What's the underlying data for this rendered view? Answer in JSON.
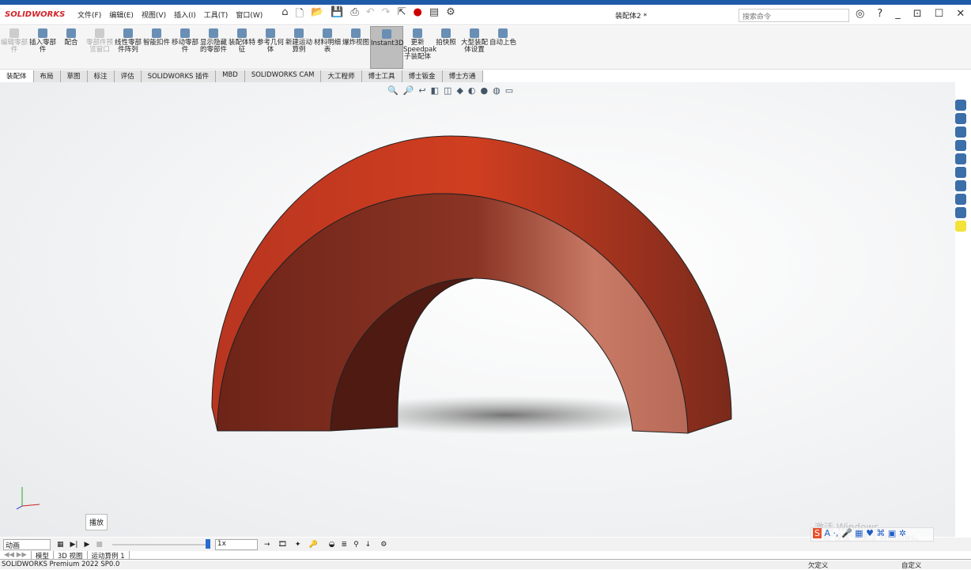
{
  "app": {
    "logo": "SOLIDWORKS",
    "title": "装配体2 *",
    "search_placeholder": "搜索命令"
  },
  "menu": [
    "文件(F)",
    "编辑(E)",
    "视图(V)",
    "插入(I)",
    "工具(T)",
    "窗口(W)"
  ],
  "ribbon": [
    {
      "label": "编辑零部件",
      "disabled": true
    },
    {
      "label": "插入零部件"
    },
    {
      "label": "配合"
    },
    {
      "label": "零部件预览窗口",
      "disabled": true
    },
    {
      "label": "线性零部件阵列"
    },
    {
      "label": "智能扣件"
    },
    {
      "label": "移动零部件"
    },
    {
      "label": "显示隐藏的零部件"
    },
    {
      "label": "装配体特征"
    },
    {
      "label": "参考几何体"
    },
    {
      "label": "新建运动算例"
    },
    {
      "label": "材料明细表"
    },
    {
      "label": "爆炸视图"
    },
    {
      "label": "Instant3D",
      "active": true
    },
    {
      "label": "更新Speedpak子装配体"
    },
    {
      "label": "拍快照"
    },
    {
      "label": "大型装配体设置"
    },
    {
      "label": "自动上色"
    }
  ],
  "tabs": [
    "装配体",
    "布局",
    "草图",
    "标注",
    "评估",
    "SOLIDWORKS 插件",
    "MBD",
    "SOLIDWORKS CAM",
    "大工程师",
    "博士工具",
    "博士钣金",
    "博士方通"
  ],
  "animation": {
    "mode": "动画",
    "speed": "1x",
    "tooltip": "播放"
  },
  "bottom_tabs": [
    "模型",
    "3D 视图",
    "运动算例 1"
  ],
  "status": {
    "version": "SOLIDWORKS Premium 2022 SP0.0",
    "state": "欠定义",
    "custom": "自定义"
  },
  "watermark": {
    "line1": "激活 Windows",
    "line2": "转到\"设置\"以激活 Windows。"
  },
  "colors": {
    "arch_top": "#c8391f",
    "arch_front_dark": "#6e2418",
    "arch_front_light": "#c87a66"
  }
}
